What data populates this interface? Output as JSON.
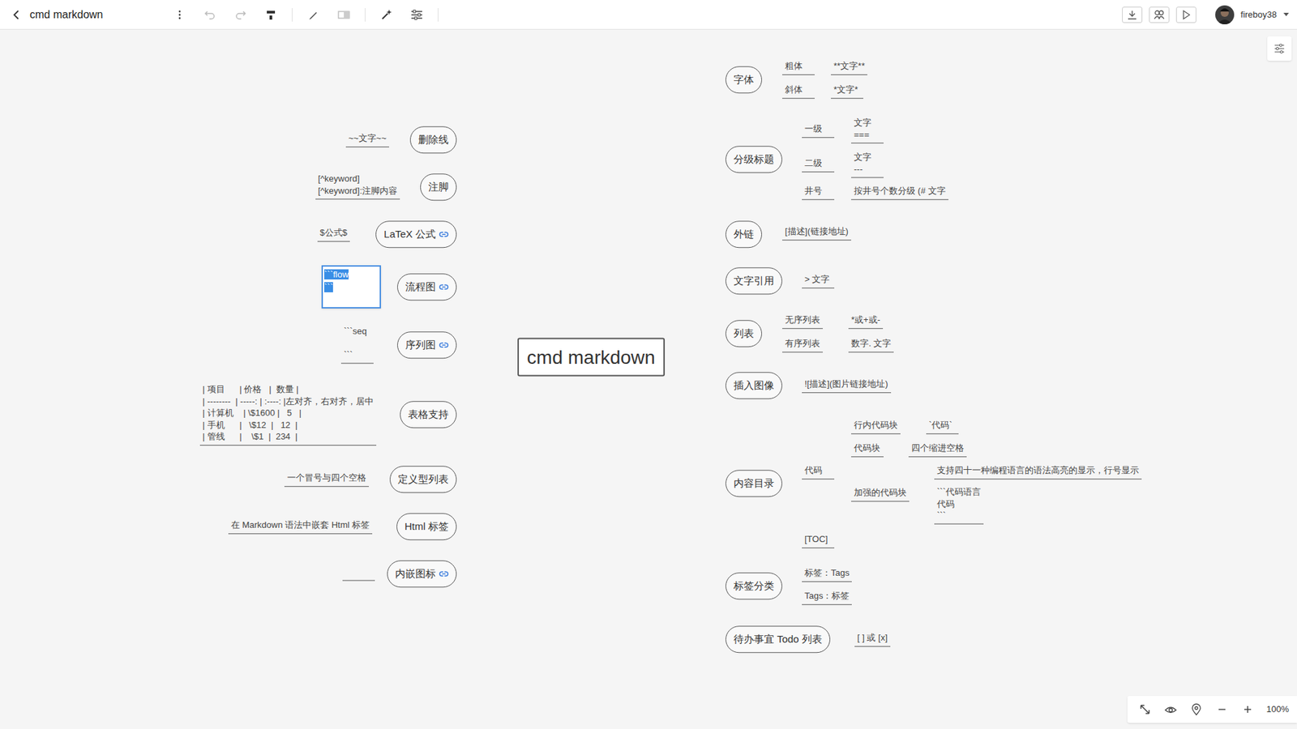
{
  "window": {
    "title": "cmd markdown"
  },
  "user": {
    "name": "fireboy38"
  },
  "zoom": "100%",
  "mindmap": {
    "root": "cmd markdown",
    "right": [
      {
        "label": "字体",
        "link": false,
        "children": [
          {
            "label": "粗体",
            "children": [
              {
                "label": "**文字**"
              }
            ]
          },
          {
            "label": "斜体",
            "children": [
              {
                "label": "*文字*"
              }
            ]
          }
        ]
      },
      {
        "label": "分级标题",
        "link": false,
        "children": [
          {
            "label": "一级",
            "children": [
              {
                "label": "文字\n==="
              }
            ]
          },
          {
            "label": "二级",
            "children": [
              {
                "label": "文字\n---"
              }
            ]
          },
          {
            "label": "井号",
            "children": [
              {
                "label": "按井号个数分级 (# 文字"
              }
            ]
          }
        ]
      },
      {
        "label": "外链",
        "link": false,
        "children": [
          {
            "label": "[描述](链接地址)"
          }
        ]
      },
      {
        "label": "文字引用",
        "link": false,
        "children": [
          {
            "label": "> 文字"
          }
        ]
      },
      {
        "label": "列表",
        "link": false,
        "children": [
          {
            "label": "无序列表",
            "children": [
              {
                "label": "*或+或-"
              }
            ]
          },
          {
            "label": "有序列表",
            "children": [
              {
                "label": "数字. 文字"
              }
            ]
          }
        ]
      },
      {
        "label": "插入图像",
        "link": false,
        "children": [
          {
            "label": "![描述](图片链接地址)"
          }
        ]
      },
      {
        "label": "内容目录",
        "link": false,
        "children": [
          {
            "label": "代码",
            "children": [
              {
                "label": "行内代码块",
                "children": [
                  {
                    "label": "`代码`"
                  }
                ]
              },
              {
                "label": "代码块",
                "children": [
                  {
                    "label": "四个缩进空格"
                  }
                ]
              },
              {
                "label": "加强的代码块",
                "children": [
                  {
                    "label": "支持四十一种编程语言的语法高亮的显示，行号显示"
                  },
                  {
                    "label": "```代码语言\n代码\n```"
                  }
                ]
              }
            ]
          },
          {
            "label": "[TOC]"
          }
        ]
      },
      {
        "label": "标签分类",
        "link": false,
        "children": [
          {
            "label": "标签：Tags"
          },
          {
            "label": "Tags：标签"
          }
        ]
      },
      {
        "label": "待办事宜 Todo 列表",
        "link": false,
        "children": [
          {
            "label": "[ ] 或 [x]"
          }
        ]
      }
    ],
    "left": [
      {
        "label": "删除线",
        "link": false,
        "children": [
          {
            "label": "~~文字~~"
          }
        ]
      },
      {
        "label": "注脚",
        "link": false,
        "children": [
          {
            "label": "[^keyword]\n[^keyword]:注脚内容"
          }
        ]
      },
      {
        "label": "LaTeX 公式",
        "link": true,
        "children": [
          {
            "label": "$公式$"
          }
        ]
      },
      {
        "label": "流程图",
        "link": true,
        "children": [
          {
            "label": "```flow\n```",
            "selected": true
          }
        ]
      },
      {
        "label": "序列图",
        "link": true,
        "children": [
          {
            "label": "```seq\n\n```"
          }
        ]
      },
      {
        "label": "表格支持",
        "link": false,
        "children": [
          {
            "label": "| 项目      | 价格   |  数量 |\n| --------  | -----: | :----: |左对齐，右对齐，居中\n| 计算机    | \\$1600 |   5   |\n| 手机      |   \\$12  |   12  |\n| 管线      |    \\$1  |  234  |"
          }
        ]
      },
      {
        "label": "定义型列表",
        "link": false,
        "children": [
          {
            "label": "一个冒号与四个空格"
          }
        ]
      },
      {
        "label": "Html 标签",
        "link": false,
        "children": [
          {
            "label": "在 Markdown 语法中嵌套 Html 标签"
          }
        ]
      },
      {
        "label": "内嵌图标",
        "link": true,
        "children": [
          {
            "label": ""
          }
        ]
      }
    ]
  }
}
